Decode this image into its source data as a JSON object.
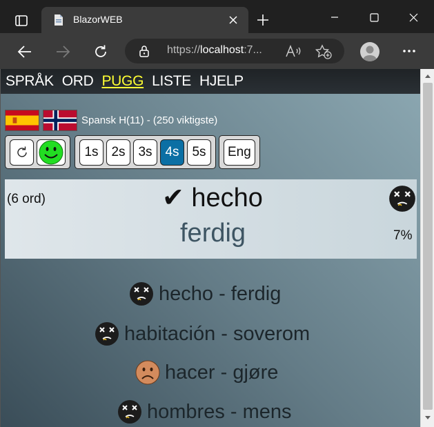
{
  "browser": {
    "tab_title": "BlazorWEB",
    "address_prefix": "https://",
    "address_host": "localhost",
    "address_suffix": ":7..."
  },
  "nav": {
    "items": [
      {
        "label": "SPRÅK"
      },
      {
        "label": "ORD"
      },
      {
        "label": "PUGG",
        "active": true
      },
      {
        "label": "LISTE"
      },
      {
        "label": "HJELP"
      }
    ]
  },
  "language": {
    "label": "Spansk H(11) - (250 viktigste)",
    "flags": [
      "spain-flag-icon",
      "norway-flag-icon"
    ]
  },
  "controls": {
    "speed_buttons": [
      {
        "label": "1s"
      },
      {
        "label": "2s"
      },
      {
        "label": "3s"
      },
      {
        "label": "4s",
        "selected": true
      },
      {
        "label": "5s"
      }
    ],
    "direction_label": "Eng",
    "icons": [
      "refresh-icon",
      "smiley-icon"
    ]
  },
  "card": {
    "count": "(6 ord)",
    "word": "✔ hecho",
    "translation": "ferdig",
    "percent": "7%",
    "face_icon": "dizzy-face-icon"
  },
  "word_list": [
    {
      "text": "hecho - ferdig",
      "icon": "dizzy-face-icon"
    },
    {
      "text": "habitación - soverom",
      "icon": "dizzy-face-icon"
    },
    {
      "text": "hacer - gjøre",
      "icon": "sad-face-icon"
    },
    {
      "text": "hombres - mens",
      "icon": "dizzy-face-icon"
    }
  ],
  "colors": {
    "nav_active": "#ffff33",
    "selected_button": "#0b6fa4",
    "smiley_green": "#22dd22",
    "sad_orange": "#d38b5d",
    "dizzy_dark": "#1c1c1c"
  }
}
